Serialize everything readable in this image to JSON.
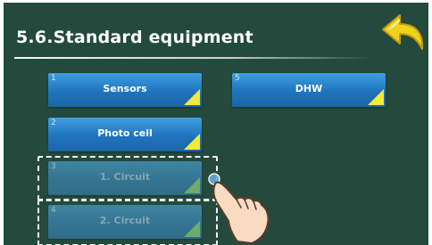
{
  "header": {
    "title": "5.6.Standard equipment"
  },
  "tiles": [
    {
      "number": "1",
      "label": "Sensors",
      "state": "active"
    },
    {
      "number": "2",
      "label": "Photo cell",
      "state": "active"
    },
    {
      "number": "3",
      "label": "1. Circuit",
      "state": "disabled"
    },
    {
      "number": "4",
      "label": "2. Circuit",
      "state": "disabled"
    },
    {
      "number": "5",
      "label": "DHW",
      "state": "active"
    }
  ],
  "icons": {
    "back": "back-arrow-icon",
    "hand": "pointing-hand-icon",
    "corner": "corner-triangle-icon"
  },
  "colors": {
    "background": "#244a3e",
    "tile": "#1f74bd",
    "tile_corner": "#f2e93a",
    "back_arrow": "#f0d21d"
  }
}
